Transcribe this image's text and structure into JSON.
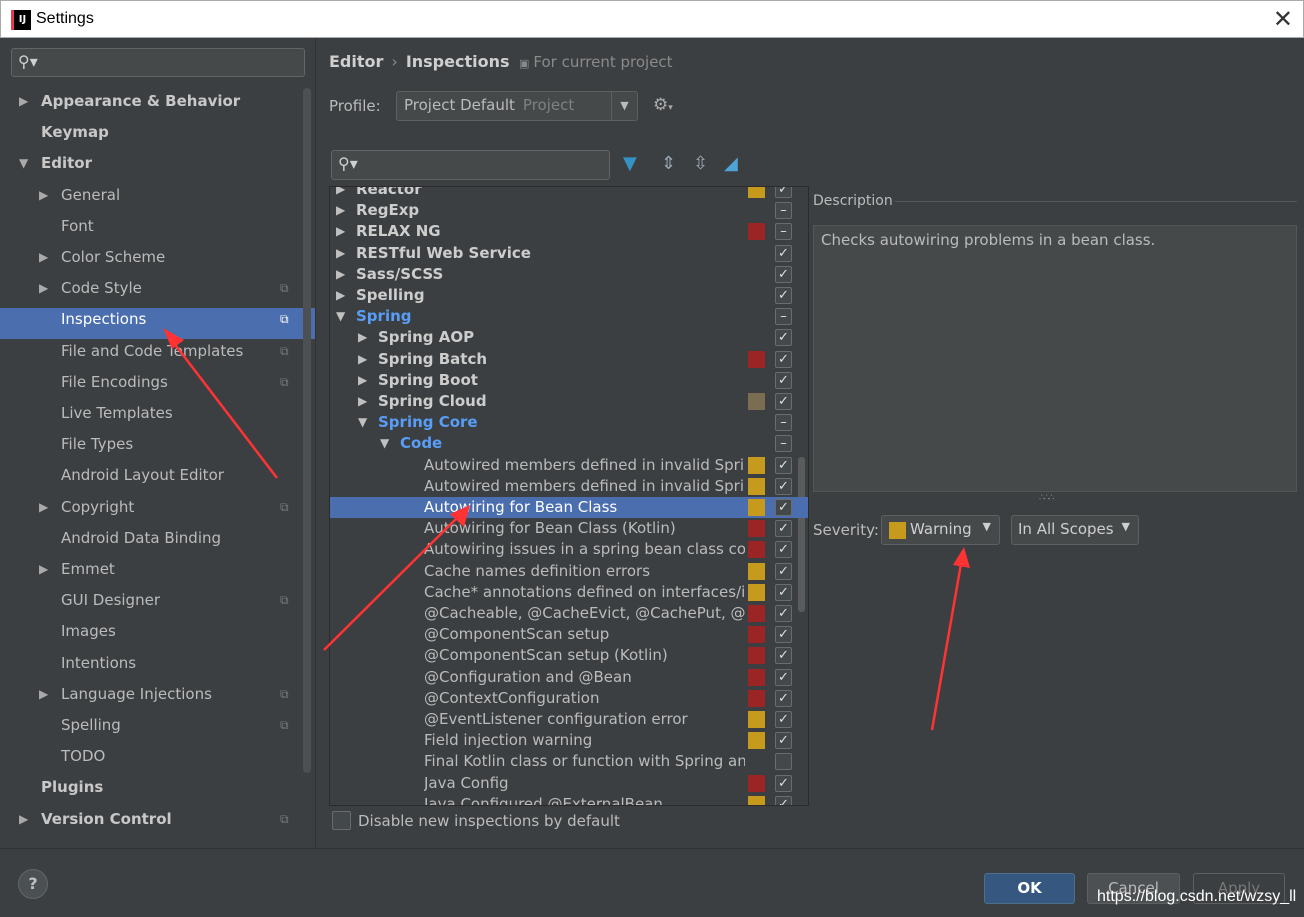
{
  "window": {
    "title": "Settings",
    "app_icon_text": "IJ",
    "close_glyph": "✕"
  },
  "sidebar": {
    "search_placeholder": "",
    "items": [
      {
        "label": "Appearance & Behavior",
        "level": 0,
        "arrow": "▶",
        "bold": true,
        "copy": false
      },
      {
        "label": "Keymap",
        "level": 0,
        "arrow": "",
        "bold": true,
        "copy": false
      },
      {
        "label": "Editor",
        "level": 0,
        "arrow": "▼",
        "bold": true,
        "copy": false
      },
      {
        "label": "General",
        "level": 1,
        "arrow": "▶",
        "bold": false,
        "copy": false
      },
      {
        "label": "Font",
        "level": 1,
        "arrow": "",
        "bold": false,
        "copy": false
      },
      {
        "label": "Color Scheme",
        "level": 1,
        "arrow": "▶",
        "bold": false,
        "copy": false
      },
      {
        "label": "Code Style",
        "level": 1,
        "arrow": "▶",
        "bold": false,
        "copy": true
      },
      {
        "label": "Inspections",
        "level": 1,
        "arrow": "",
        "bold": false,
        "copy": true,
        "selected": true
      },
      {
        "label": "File and Code Templates",
        "level": 1,
        "arrow": "",
        "bold": false,
        "copy": true
      },
      {
        "label": "File Encodings",
        "level": 1,
        "arrow": "",
        "bold": false,
        "copy": true
      },
      {
        "label": "Live Templates",
        "level": 1,
        "arrow": "",
        "bold": false,
        "copy": false
      },
      {
        "label": "File Types",
        "level": 1,
        "arrow": "",
        "bold": false,
        "copy": false
      },
      {
        "label": "Android Layout Editor",
        "level": 1,
        "arrow": "",
        "bold": false,
        "copy": false
      },
      {
        "label": "Copyright",
        "level": 1,
        "arrow": "▶",
        "bold": false,
        "copy": true
      },
      {
        "label": "Android Data Binding",
        "level": 1,
        "arrow": "",
        "bold": false,
        "copy": false
      },
      {
        "label": "Emmet",
        "level": 1,
        "arrow": "▶",
        "bold": false,
        "copy": false
      },
      {
        "label": "GUI Designer",
        "level": 1,
        "arrow": "",
        "bold": false,
        "copy": true
      },
      {
        "label": "Images",
        "level": 1,
        "arrow": "",
        "bold": false,
        "copy": false
      },
      {
        "label": "Intentions",
        "level": 1,
        "arrow": "",
        "bold": false,
        "copy": false
      },
      {
        "label": "Language Injections",
        "level": 1,
        "arrow": "▶",
        "bold": false,
        "copy": true
      },
      {
        "label": "Spelling",
        "level": 1,
        "arrow": "",
        "bold": false,
        "copy": true
      },
      {
        "label": "TODO",
        "level": 1,
        "arrow": "",
        "bold": false,
        "copy": false
      },
      {
        "label": "Plugins",
        "level": 0,
        "arrow": "",
        "bold": true,
        "copy": false
      },
      {
        "label": "Version Control",
        "level": 0,
        "arrow": "▶",
        "bold": true,
        "copy": true
      }
    ]
  },
  "breadcrumb": {
    "parent": "Editor",
    "separator": "›",
    "current": "Inspections",
    "note": "For current project"
  },
  "profile": {
    "label": "Profile:",
    "name": "Project Default",
    "type": "Project"
  },
  "inspections_tree": {
    "search_placeholder": "",
    "rows": [
      {
        "label": "Reactor",
        "indent": 0,
        "arrow": "▶",
        "style": "bold",
        "severity": "#c69a1c",
        "check": "✓"
      },
      {
        "label": "RegExp",
        "indent": 0,
        "arrow": "▶",
        "style": "bold",
        "severity": "",
        "check": "–"
      },
      {
        "label": "RELAX NG",
        "indent": 0,
        "arrow": "▶",
        "style": "bold",
        "severity": "#9b2424",
        "check": "–"
      },
      {
        "label": "RESTful Web Service",
        "indent": 0,
        "arrow": "▶",
        "style": "bold",
        "severity": "",
        "check": "✓"
      },
      {
        "label": "Sass/SCSS",
        "indent": 0,
        "arrow": "▶",
        "style": "bold",
        "severity": "",
        "check": "✓"
      },
      {
        "label": "Spelling",
        "indent": 0,
        "arrow": "▶",
        "style": "bold",
        "severity": "",
        "check": "✓"
      },
      {
        "label": "Spring",
        "indent": 0,
        "arrow": "▼",
        "style": "link",
        "severity": "",
        "check": "–"
      },
      {
        "label": "Spring AOP",
        "indent": 1,
        "arrow": "▶",
        "style": "bold",
        "severity": "",
        "check": "✓"
      },
      {
        "label": "Spring Batch",
        "indent": 1,
        "arrow": "▶",
        "style": "bold",
        "severity": "#9b2424",
        "check": "✓"
      },
      {
        "label": "Spring Boot",
        "indent": 1,
        "arrow": "▶",
        "style": "bold",
        "severity": "",
        "check": "✓"
      },
      {
        "label": "Spring Cloud",
        "indent": 1,
        "arrow": "▶",
        "style": "bold",
        "severity": "#7a6d52",
        "check": "✓"
      },
      {
        "label": "Spring Core",
        "indent": 1,
        "arrow": "▼",
        "style": "link",
        "severity": "",
        "check": "–"
      },
      {
        "label": "Code",
        "indent": 2,
        "arrow": "▼",
        "style": "link",
        "severity": "",
        "check": "–"
      },
      {
        "label": "Autowired members defined in invalid Spring bean",
        "indent": 3,
        "arrow": "",
        "style": "norm",
        "severity": "#c69a1c",
        "check": "✓"
      },
      {
        "label": "Autowired members defined in invalid Spring bean (Kotlin)",
        "indent": 3,
        "arrow": "",
        "style": "norm",
        "severity": "#c69a1c",
        "check": "✓"
      },
      {
        "label": "Autowiring for Bean Class",
        "indent": 3,
        "arrow": "",
        "style": "norm",
        "severity": "#c69a1c",
        "check": "✓",
        "selected": true
      },
      {
        "label": "Autowiring for Bean Class (Kotlin)",
        "indent": 3,
        "arrow": "",
        "style": "norm",
        "severity": "#9b2424",
        "check": "✓"
      },
      {
        "label": "Autowiring issues in a spring bean class constructor",
        "indent": 3,
        "arrow": "",
        "style": "norm",
        "severity": "#9b2424",
        "check": "✓"
      },
      {
        "label": "Cache names definition errors",
        "indent": 3,
        "arrow": "",
        "style": "norm",
        "severity": "#c69a1c",
        "check": "✓"
      },
      {
        "label": "Cache* annotations defined on interfaces/interface methods",
        "indent": 3,
        "arrow": "",
        "style": "norm",
        "severity": "#c69a1c",
        "check": "✓"
      },
      {
        "label": "@Cacheable, @CacheEvict, @CachePut, @Caching",
        "indent": 3,
        "arrow": "",
        "style": "norm",
        "severity": "#9b2424",
        "check": "✓"
      },
      {
        "label": "@ComponentScan setup",
        "indent": 3,
        "arrow": "",
        "style": "norm",
        "severity": "#9b2424",
        "check": "✓"
      },
      {
        "label": "@ComponentScan setup (Kotlin)",
        "indent": 3,
        "arrow": "",
        "style": "norm",
        "severity": "#9b2424",
        "check": "✓"
      },
      {
        "label": "@Configuration and @Bean",
        "indent": 3,
        "arrow": "",
        "style": "norm",
        "severity": "#9b2424",
        "check": "✓"
      },
      {
        "label": "@ContextConfiguration",
        "indent": 3,
        "arrow": "",
        "style": "norm",
        "severity": "#9b2424",
        "check": "✓"
      },
      {
        "label": "@EventListener configuration error",
        "indent": 3,
        "arrow": "",
        "style": "norm",
        "severity": "#c69a1c",
        "check": "✓"
      },
      {
        "label": "Field injection warning",
        "indent": 3,
        "arrow": "",
        "style": "norm",
        "severity": "#c69a1c",
        "check": "✓"
      },
      {
        "label": "Final Kotlin class or function with Spring annotation",
        "indent": 3,
        "arrow": "",
        "style": "norm",
        "severity": "",
        "check": ""
      },
      {
        "label": "Java Config",
        "indent": 3,
        "arrow": "",
        "style": "norm",
        "severity": "#9b2424",
        "check": "✓"
      },
      {
        "label": "Java Configured @ExternalBean",
        "indent": 3,
        "arrow": "",
        "style": "norm",
        "severity": "#c69a1c",
        "check": "✓"
      }
    ]
  },
  "description": {
    "label": "Description",
    "text": "Checks autowiring problems in a bean class."
  },
  "severity": {
    "label": "Severity:",
    "value": "Warning",
    "color": "#c69a1c",
    "scope": "In All Scopes"
  },
  "bottom": {
    "disable_new_label": "Disable new inspections by default"
  },
  "footer": {
    "help": "?",
    "ok": "OK",
    "cancel": "Cancel",
    "apply": "Apply",
    "watermark": "https://blog.csdn.net/wzsy_ll"
  },
  "colors": {
    "accent": "#4b6eaf",
    "link": "#589df6",
    "annotation_arrow": "#ff3333"
  }
}
